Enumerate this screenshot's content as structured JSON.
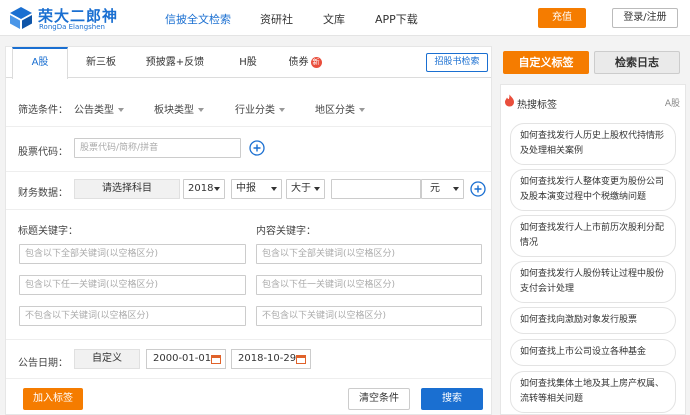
{
  "header": {
    "logo_cn": "荣大二郎神",
    "logo_en": "RongDa Elangshen",
    "nav": [
      "信披全文检索",
      "资研社",
      "文库",
      "APP下载"
    ],
    "recharge": "充值",
    "login": "登录/注册"
  },
  "tabs": [
    "A股",
    "新三板",
    "预披露+反馈",
    "H股",
    "债券"
  ],
  "new_badge": "新",
  "prospectus_button": "招股书检索",
  "filter": {
    "label": "筛选条件：",
    "options": [
      "公告类型",
      "板块类型",
      "行业分类",
      "地区分类"
    ]
  },
  "stock_code": {
    "label": "股票代码：",
    "placeholder": "股票代码/简称/拼音"
  },
  "finance": {
    "label": "财务数据：",
    "subject": "请选择科目",
    "year": "2018",
    "period": "中报",
    "compare": "大于",
    "unit": "元"
  },
  "title_keywords": {
    "label": "标题关键字：",
    "all": "包含以下全部关键词(以空格区分)",
    "any": "包含以下任一关键词(以空格区分)",
    "none": "不包含以下关键词(以空格区分)"
  },
  "content_keywords": {
    "label": "内容关键字：",
    "all": "包含以下全部关键词(以空格区分)",
    "any": "包含以下任一关键词(以空格区分)",
    "none": "不包含以下关键词(以空格区分)"
  },
  "date": {
    "label": "公告日期：",
    "custom": "自定义",
    "start": "2000-01-01",
    "end": "2018-10-29"
  },
  "buttons": {
    "add_tag": "加入标签",
    "clear": "清空条件",
    "search": "搜索"
  },
  "right": {
    "custom_tag": "自定义标签",
    "search_log": "检索日志",
    "hot_title": "热搜标签",
    "hot_stock": "A股",
    "hot_items": [
      "如何查找发行人历史上股权代持情形及处理相关案例",
      "如何查找发行人整体变更为股份公司及股本演变过程中个税缴纳问题",
      "如何查找发行人上市前历次股利分配情况",
      "如何查找发行人股份转让过程中股份支付会计处理",
      "如何查找向激励对象发行股票",
      "如何查找上市公司设立各种基金",
      "如何查找集体土地及其上房产权属、流转等相关问题"
    ]
  },
  "colors": {
    "brand_blue": "#1a6fd1",
    "accent_orange": "#f57c00",
    "badge_red": "#e94e3c"
  }
}
